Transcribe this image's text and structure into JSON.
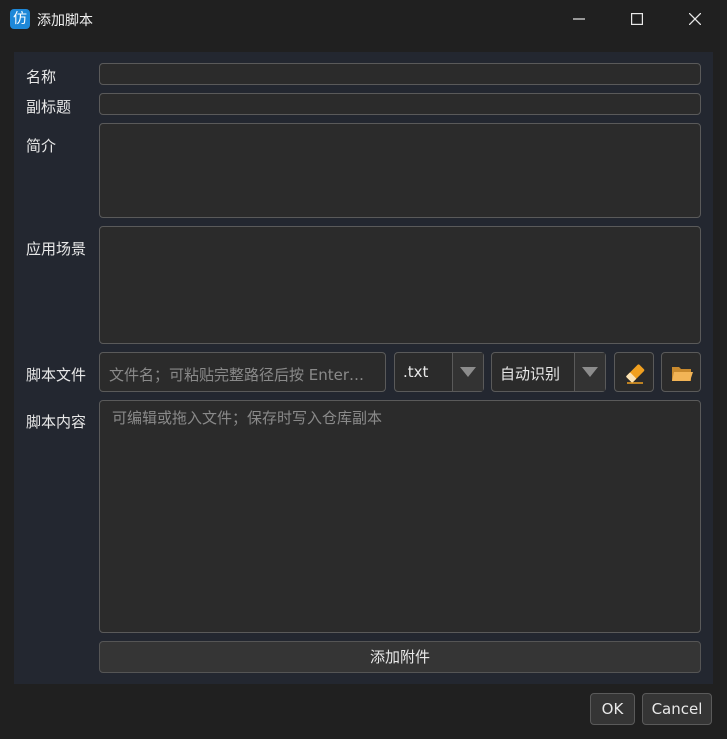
{
  "window": {
    "app_icon_glyph": "仿",
    "title": "添加脚本",
    "minimize_icon": "minimize-icon",
    "maximize_icon": "maximize-icon",
    "close_icon": "close-icon"
  },
  "form": {
    "name_label": "名称",
    "name_value": "",
    "subtitle_label": "副标题",
    "subtitle_value": "",
    "intro_label": "简介",
    "intro_value": "",
    "scenario_label": "应用场景",
    "scenario_value": "",
    "file_label": "脚本文件",
    "file_placeholder": "文件名；可粘贴完整路径后按 Enter…",
    "extension_value": ".txt",
    "encoding_value": "自动识别",
    "content_label": "脚本内容",
    "content_placeholder": "可编辑或拖入文件；保存时写入仓库副本",
    "add_attachment_label": "添加附件"
  },
  "dialog": {
    "ok_label": "OK",
    "cancel_label": "Cancel"
  },
  "colors": {
    "accent": "#1e88d8",
    "eraser": "#f0a020",
    "folder": "#e8a040"
  }
}
